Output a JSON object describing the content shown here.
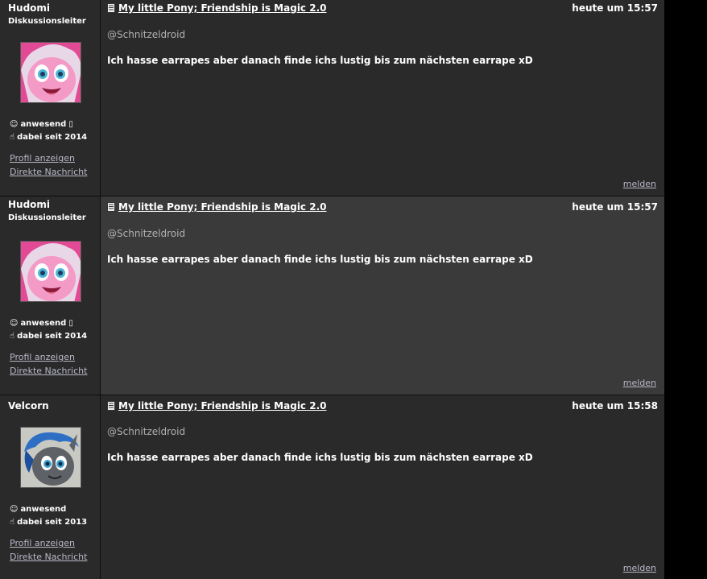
{
  "colors": {
    "page_bg": "#000000",
    "post_bg": "#2a2a2a",
    "post_bg_highlight": "#3a3a3a",
    "link": "#b8b8c8",
    "mention": "#b0b0b0"
  },
  "posts": [
    {
      "author": "Hudomi",
      "rank": "Diskussionsleiter",
      "avatar": "pinkie-pie-avatar",
      "status": "anwesend",
      "since": "dabei seit 2014",
      "profile_link": "Profil anzeigen",
      "message_link": "Direkte Nachricht",
      "thread_title": "My little Pony; Friendship is Magic 2.0",
      "time": "heute um 15:57",
      "mention": "@Schnitzeldroid",
      "text": "Ich hasse earrapes aber danach finde ichs lustig bis zum nächsten earrape xD",
      "report": "melden"
    },
    {
      "author": "Hudomi",
      "rank": "Diskussionsleiter",
      "avatar": "pinkie-pie-avatar",
      "status": "anwesend",
      "since": "dabei seit 2014",
      "profile_link": "Profil anzeigen",
      "message_link": "Direkte Nachricht",
      "thread_title": "My little Pony; Friendship is Magic 2.0",
      "time": "heute um 15:57",
      "mention": "@Schnitzeldroid",
      "text": "Ich hasse earrapes aber danach finde ichs lustig bis zum nächsten earrape xD",
      "report": "melden"
    },
    {
      "author": "Velcorn",
      "rank": "",
      "avatar": "grey-pony-avatar",
      "status": "anwesend",
      "since": "dabei seit 2013",
      "profile_link": "Profil anzeigen",
      "message_link": "Direkte Nachricht",
      "thread_title": "My little Pony; Friendship is Magic 2.0",
      "time": "heute um 15:58",
      "mention": "@Schnitzeldroid",
      "text": "Ich hasse earrapes aber danach finde ichs lustig bis zum nächsten earrape xD",
      "report": "melden"
    }
  ]
}
